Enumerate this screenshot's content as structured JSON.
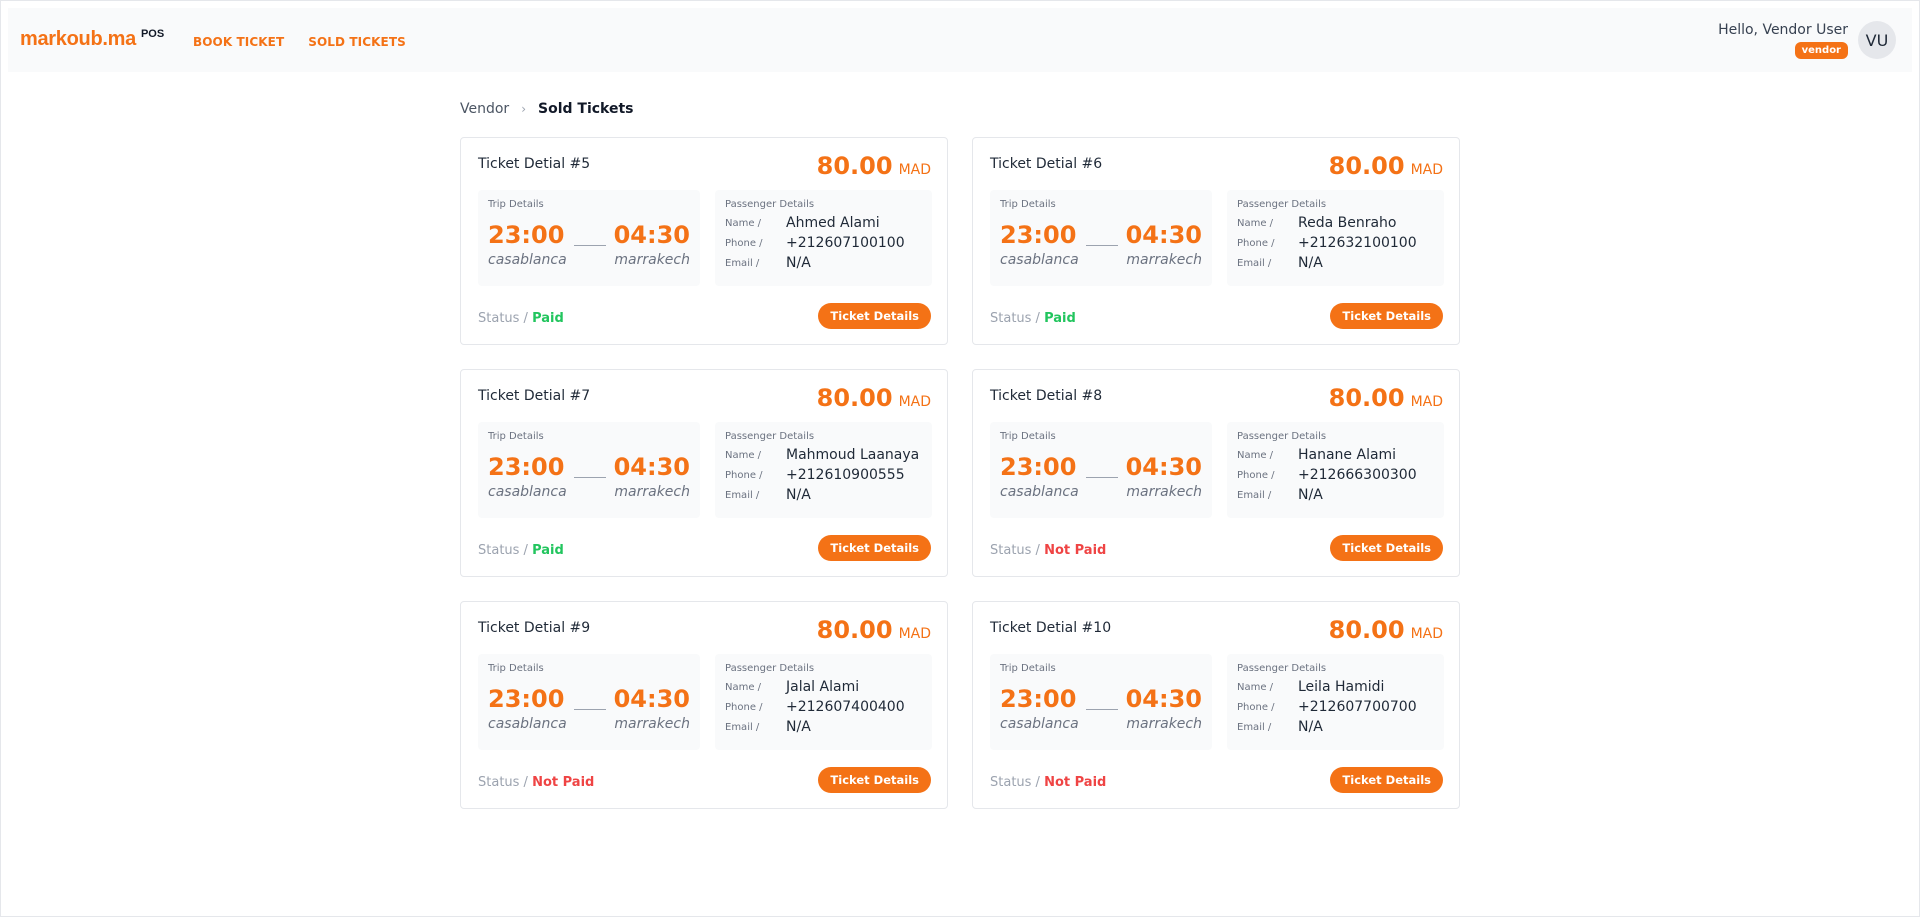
{
  "header": {
    "logo_text": "markoub.ma",
    "logo_badge": "POS",
    "nav": [
      {
        "label": "BOOK TICKET"
      },
      {
        "label": "SOLD TICKETS"
      }
    ],
    "greeting": "Hello, Vendor User",
    "role_badge": "vendor",
    "avatar_initials": "VU"
  },
  "breadcrumb": {
    "parent": "Vendor",
    "separator": "›",
    "current": "Sold Tickets"
  },
  "labels": {
    "trip_details": "Trip Details",
    "passenger_details": "Passenger Details",
    "name_key": "Name /",
    "phone_key": "Phone /",
    "email_key": "Email /",
    "status_key": "Status /",
    "details_button": "Ticket Details"
  },
  "tickets": [
    {
      "title": "Ticket Detial #5",
      "price": "80.00",
      "currency": "MAD",
      "departure_time": "23:00",
      "arrival_time": "04:30",
      "from": "casablanca",
      "to": "marrakech",
      "name": "Ahmed Alami",
      "phone": "+212607100100",
      "email": "N/A",
      "status": "Paid",
      "status_color": "#22c55e"
    },
    {
      "title": "Ticket Detial #6",
      "price": "80.00",
      "currency": "MAD",
      "departure_time": "23:00",
      "arrival_time": "04:30",
      "from": "casablanca",
      "to": "marrakech",
      "name": "Reda Benraho",
      "phone": "+212632100100",
      "email": "N/A",
      "status": "Paid",
      "status_color": "#22c55e"
    },
    {
      "title": "Ticket Detial #7",
      "price": "80.00",
      "currency": "MAD",
      "departure_time": "23:00",
      "arrival_time": "04:30",
      "from": "casablanca",
      "to": "marrakech",
      "name": "Mahmoud Laanaya",
      "phone": "+212610900555",
      "email": "N/A",
      "status": "Paid",
      "status_color": "#22c55e"
    },
    {
      "title": "Ticket Detial #8",
      "price": "80.00",
      "currency": "MAD",
      "departure_time": "23:00",
      "arrival_time": "04:30",
      "from": "casablanca",
      "to": "marrakech",
      "name": "Hanane Alami",
      "phone": "+212666300300",
      "email": "N/A",
      "status": "Not Paid",
      "status_color": "#ef4444"
    },
    {
      "title": "Ticket Detial #9",
      "price": "80.00",
      "currency": "MAD",
      "departure_time": "23:00",
      "arrival_time": "04:30",
      "from": "casablanca",
      "to": "marrakech",
      "name": "Jalal Alami",
      "phone": "+212607400400",
      "email": "N/A",
      "status": "Not Paid",
      "status_color": "#ef4444"
    },
    {
      "title": "Ticket Detial #10",
      "price": "80.00",
      "currency": "MAD",
      "departure_time": "23:00",
      "arrival_time": "04:30",
      "from": "casablanca",
      "to": "marrakech",
      "name": "Leila Hamidi",
      "phone": "+212607700700",
      "email": "N/A",
      "status": "Not Paid",
      "status_color": "#ef4444"
    }
  ],
  "colors": {
    "accent": "#f47216",
    "paid": "#22c55e",
    "not_paid": "#ef4444"
  }
}
